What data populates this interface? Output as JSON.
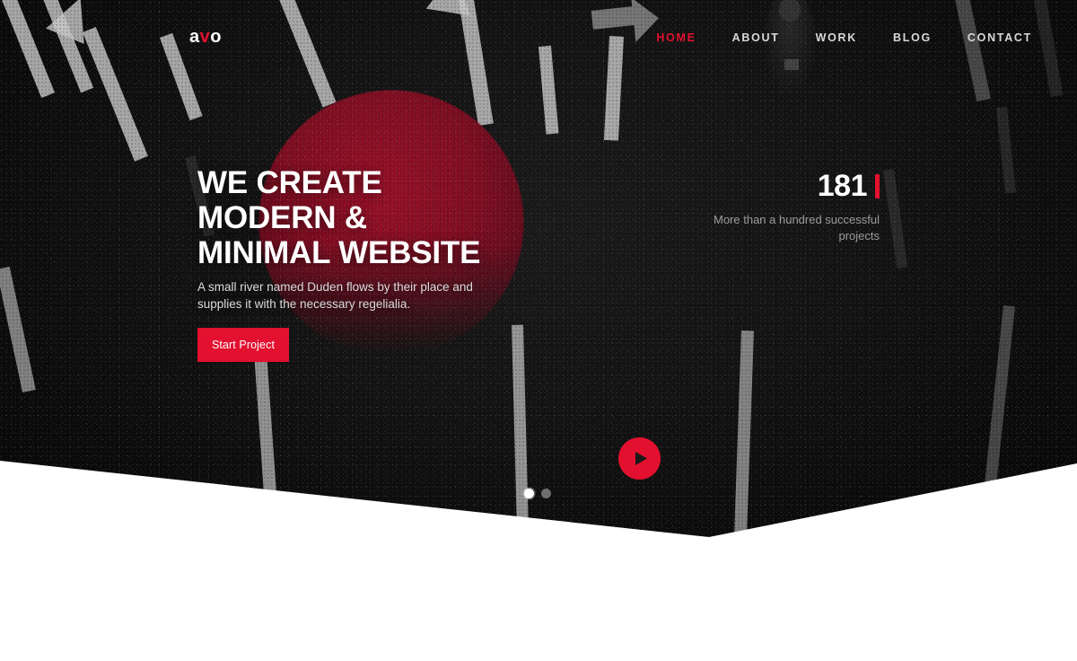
{
  "brand": {
    "prefix": "a",
    "accent": "v",
    "suffix": "o",
    "accent_color": "#e3102f"
  },
  "nav": {
    "items": [
      {
        "label": "HOME",
        "active": true
      },
      {
        "label": "ABOUT",
        "active": false
      },
      {
        "label": "WORK",
        "active": false
      },
      {
        "label": "BLOG",
        "active": false
      },
      {
        "label": "CONTACT",
        "active": false
      }
    ]
  },
  "hero": {
    "headline_lines": [
      "WE CREATE",
      "MODERN &",
      "MINIMAL WEBSITE"
    ],
    "paragraph": "A small river named Duden flows by their place and supplies it with the necessary regelialia.",
    "cta_label": "Start Project",
    "play_label": "play-video",
    "background": "aerial-asphalt-road-markings"
  },
  "stats": {
    "number": "181",
    "caption": "More than a hundred successful projects"
  },
  "carousel": {
    "slides": [
      {
        "index": 1,
        "active": true
      },
      {
        "index": 2,
        "active": false
      }
    ]
  },
  "colors": {
    "accent_red": "#e3102f",
    "dome_red": "#8e0f26",
    "hero_bg": "#0d0d0d",
    "page_bg": "#ffffff",
    "nav_link": "#d8d8d8",
    "muted_text": "#9c9c9c"
  }
}
